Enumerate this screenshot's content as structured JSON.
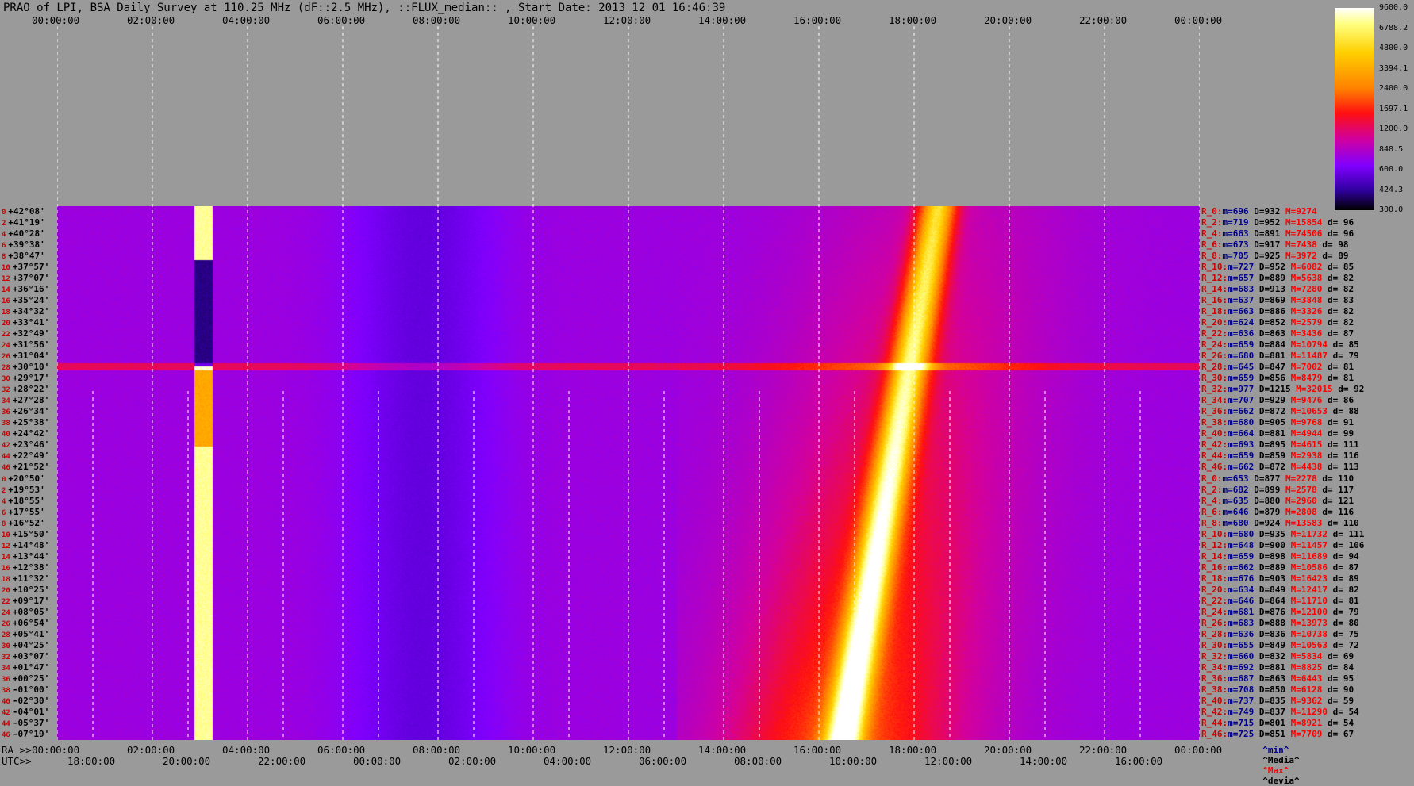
{
  "title": "PRAO of LPI, BSA Daily Survey at 110.25 MHz (dF::2.5 MHz), ::FLUX_median:: , Start Date: 2013 12 01 16:46:39",
  "chart_data": {
    "type": "heatmap",
    "title": "PRAO of LPI, BSA Daily Survey at 110.25 MHz (dF::2.5 MHz), ::FLUX_median:: , Start Date: 2013 12 01 16:46:39",
    "x_top_labels": [
      "00:00:00",
      "02:00:00",
      "04:00:00",
      "06:00:00",
      "08:00:00",
      "10:00:00",
      "12:00:00",
      "14:00:00",
      "16:00:00",
      "18:00:00",
      "20:00:00",
      "22:00:00",
      "00:00:00"
    ],
    "x_bottom_ra_prefix": "RA >>",
    "x_bottom_ra_labels": [
      "00:00:00",
      "02:00:00",
      "04:00:00",
      "06:00:00",
      "08:00:00",
      "10:00:00",
      "12:00:00",
      "14:00:00",
      "16:00:00",
      "18:00:00",
      "20:00:00",
      "22:00:00",
      "00:00:00"
    ],
    "x_bottom_utc_prefix": "UTC>>",
    "x_bottom_utc_labels": [
      "18:00:00",
      "20:00:00",
      "22:00:00",
      "00:00:00",
      "02:00:00",
      "04:00:00",
      "06:00:00",
      "08:00:00",
      "10:00:00",
      "12:00:00",
      "14:00:00",
      "16:00:00"
    ],
    "colorbar_ticks": [
      "9600.0",
      "6788.2",
      "4800.0",
      "3394.1",
      "2400.0",
      "1697.1",
      "1200.0",
      "848.5",
      "600.0",
      "424.3",
      "300.0"
    ],
    "declinations": [
      "+42°08'",
      "+41°19'",
      "+40°28'",
      "+39°38'",
      "+38°47'",
      "+37°57'",
      "+37°07'",
      "+36°16'",
      "+35°24'",
      "+34°32'",
      "+33°41'",
      "+32°49'",
      "+31°56'",
      "+31°04'",
      "+30°10'",
      "+29°17'",
      "+28°22'",
      "+27°28'",
      "+26°34'",
      "+25°38'",
      "+24°42'",
      "+23°46'",
      "+22°49'",
      "+21°52'",
      "+20°50'",
      "+19°53'",
      "+18°55'",
      "+17°55'",
      "+16°52'",
      "+15°50'",
      "+14°48'",
      "+13°44'",
      "+12°38'",
      "+11°32'",
      "+10°25'",
      "+09°17'",
      "+08°05'",
      "+06°54'",
      "+05°41'",
      "+04°25'",
      "+03°07'",
      "+01°47'",
      "+00°25'",
      "-01°00'",
      "-02°30'",
      "-04°01'",
      "-05°37'",
      "-07°19'"
    ],
    "dec_indices": [
      "0",
      "2",
      "4",
      "6",
      "8",
      "10",
      "12",
      "14",
      "16",
      "18",
      "20",
      "22",
      "24",
      "26",
      "28",
      "30",
      "32",
      "34",
      "36",
      "38",
      "40",
      "42",
      "44",
      "46",
      "0",
      "2",
      "4",
      "6",
      "8",
      "10",
      "12",
      "14",
      "16",
      "18",
      "20",
      "22",
      "24",
      "26",
      "28",
      "30",
      "32",
      "34",
      "36",
      "38",
      "40",
      "42",
      "44",
      "46"
    ],
    "row_stats": [
      {
        "r": "R_0:",
        "min": "696",
        "med": "932",
        "max": "9274",
        "dev": ""
      },
      {
        "r": "R_2:",
        "min": "719",
        "med": "952",
        "max": "15854",
        "dev": "96"
      },
      {
        "r": "R_4:",
        "min": "663",
        "med": "891",
        "max": "74506",
        "dev": "96"
      },
      {
        "r": "R_6:",
        "min": "673",
        "med": "917",
        "max": "7438",
        "dev": "98"
      },
      {
        "r": "R_8:",
        "min": "705",
        "med": "925",
        "max": "3972",
        "dev": "89"
      },
      {
        "r": "R_10:",
        "min": "727",
        "med": "952",
        "max": "6082",
        "dev": "85"
      },
      {
        "r": "R_12:",
        "min": "657",
        "med": "889",
        "max": "5638",
        "dev": "82"
      },
      {
        "r": "R_14:",
        "min": "683",
        "med": "913",
        "max": "7280",
        "dev": "82"
      },
      {
        "r": "R_16:",
        "min": "637",
        "med": "869",
        "max": "3848",
        "dev": "83"
      },
      {
        "r": "R_18:",
        "min": "663",
        "med": "886",
        "max": "3326",
        "dev": "82"
      },
      {
        "r": "R_20:",
        "min": "624",
        "med": "852",
        "max": "2579",
        "dev": "82"
      },
      {
        "r": "R_22:",
        "min": "636",
        "med": "863",
        "max": "3436",
        "dev": "87"
      },
      {
        "r": "R_24:",
        "min": "659",
        "med": "884",
        "max": "10794",
        "dev": "85"
      },
      {
        "r": "R_26:",
        "min": "680",
        "med": "881",
        "max": "11487",
        "dev": "79"
      },
      {
        "r": "R_28:",
        "min": "645",
        "med": "847",
        "max": "7002",
        "dev": "81"
      },
      {
        "r": "R_30:",
        "min": "659",
        "med": "856",
        "max": "8479",
        "dev": "81"
      },
      {
        "r": "R_32:",
        "min": "977",
        "med": "1215",
        "max": "32015",
        "dev": "92"
      },
      {
        "r": "R_34:",
        "min": "707",
        "med": "929",
        "max": "9476",
        "dev": "86"
      },
      {
        "r": "R_36:",
        "min": "662",
        "med": "872",
        "max": "10653",
        "dev": "88"
      },
      {
        "r": "R_38:",
        "min": "680",
        "med": "905",
        "max": "9768",
        "dev": "91"
      },
      {
        "r": "R_40:",
        "min": "664",
        "med": "881",
        "max": "4944",
        "dev": "99"
      },
      {
        "r": "R_42:",
        "min": "693",
        "med": "895",
        "max": "4615",
        "dev": "111"
      },
      {
        "r": "R_44:",
        "min": "659",
        "med": "859",
        "max": "2938",
        "dev": "116"
      },
      {
        "r": "R_46:",
        "min": "662",
        "med": "872",
        "max": "4438",
        "dev": "113"
      },
      {
        "r": "R_0:",
        "min": "653",
        "med": "877",
        "max": "2278",
        "dev": "110"
      },
      {
        "r": "R_2:",
        "min": "682",
        "med": "899",
        "max": "2578",
        "dev": "117"
      },
      {
        "r": "R_4:",
        "min": "635",
        "med": "880",
        "max": "2960",
        "dev": "121"
      },
      {
        "r": "R_6:",
        "min": "646",
        "med": "879",
        "max": "2808",
        "dev": "116"
      },
      {
        "r": "R_8:",
        "min": "680",
        "med": "924",
        "max": "13583",
        "dev": "110"
      },
      {
        "r": "R_10:",
        "min": "680",
        "med": "935",
        "max": "11732",
        "dev": "111"
      },
      {
        "r": "R_12:",
        "min": "648",
        "med": "900",
        "max": "11457",
        "dev": "106"
      },
      {
        "r": "R_14:",
        "min": "659",
        "med": "898",
        "max": "11689",
        "dev": "94"
      },
      {
        "r": "R_16:",
        "min": "662",
        "med": "889",
        "max": "10586",
        "dev": "87"
      },
      {
        "r": "R_18:",
        "min": "676",
        "med": "903",
        "max": "16423",
        "dev": "89"
      },
      {
        "r": "R_20:",
        "min": "634",
        "med": "849",
        "max": "12417",
        "dev": "82"
      },
      {
        "r": "R_22:",
        "min": "646",
        "med": "864",
        "max": "11710",
        "dev": "81"
      },
      {
        "r": "R_24:",
        "min": "681",
        "med": "876",
        "max": "12100",
        "dev": "79"
      },
      {
        "r": "R_26:",
        "min": "683",
        "med": "888",
        "max": "13973",
        "dev": "80"
      },
      {
        "r": "R_28:",
        "min": "636",
        "med": "836",
        "max": "10738",
        "dev": "75"
      },
      {
        "r": "R_30:",
        "min": "655",
        "med": "849",
        "max": "10563",
        "dev": "72"
      },
      {
        "r": "R_32:",
        "min": "660",
        "med": "832",
        "max": "5834",
        "dev": "69"
      },
      {
        "r": "R_34:",
        "min": "692",
        "med": "881",
        "max": "8825",
        "dev": "84"
      },
      {
        "r": "R_36:",
        "min": "687",
        "med": "863",
        "max": "6443",
        "dev": "95"
      },
      {
        "r": "R_38:",
        "min": "708",
        "med": "850",
        "max": "6128",
        "dev": "90"
      },
      {
        "r": "R_40:",
        "min": "737",
        "med": "835",
        "max": "9362",
        "dev": "59"
      },
      {
        "r": "R_42:",
        "min": "749",
        "med": "837",
        "max": "11290",
        "dev": "54"
      },
      {
        "r": "R_44:",
        "min": "715",
        "med": "801",
        "max": "8921",
        "dev": "54"
      },
      {
        "r": "R_46:",
        "min": "725",
        "med": "851",
        "max": "7709",
        "dev": "67"
      }
    ],
    "legend_bottom": {
      "min": "^min^",
      "med": "^Media^",
      "max": "^Max^",
      "dev": "^devia^"
    },
    "colors": {
      "background": "#9a9a9a",
      "grid": "#ffffff"
    }
  }
}
